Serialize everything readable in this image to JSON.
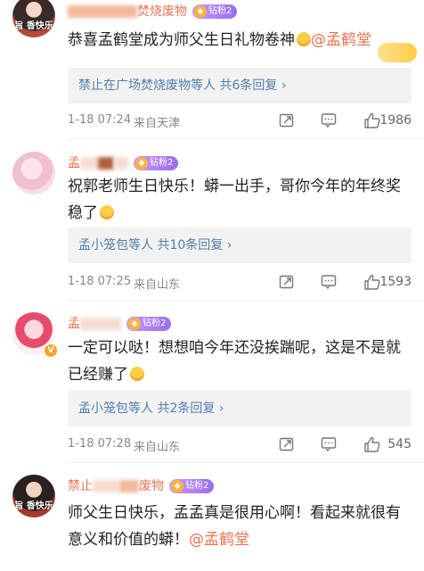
{
  "comments": [
    {
      "avatar_text": "旨 香快乐",
      "username_suffix": "焚烧废物",
      "badge": "钻粉2",
      "text": "恭喜孟鹤堂成为师父生日礼物卷神",
      "mention": "@孟鹤堂",
      "reply_summary": "禁止在广场焚烧废物等人",
      "reply_count": "共6条回复",
      "date": "1-18 07:24",
      "source": "来自天津",
      "likes": "1986"
    },
    {
      "avatar_text": "",
      "username_prefix": "孟",
      "badge": "钻粉2",
      "text": "祝郭老师生日快乐！蟒一出手，哥你今年的年终奖稳了",
      "reply_summary": "孟小笼包等人",
      "reply_count": "共10条回复",
      "date": "1-18 07:25",
      "source": "来自山东",
      "likes": "1593"
    },
    {
      "avatar_text": "",
      "username_prefix": "孟",
      "badge": "钻粉2",
      "text": "一定可以哒！想想咱今年还没挨踹呢，这是不是就已经赚了",
      "reply_summary": "孟小笼包等人",
      "reply_count": "共2条回复",
      "date": "1-18 07:28",
      "source": "来自山东",
      "likes": "545"
    },
    {
      "avatar_text": "旨 香快乐",
      "username_prefix": "禁止",
      "username_suffix": "废物",
      "badge": "钻粉2",
      "text": "师父生日快乐，孟孟真是很用心啊！看起来就很有意义和价值的蟒！",
      "mention": "@孟鹤堂"
    }
  ],
  "reply_arrow": "›",
  "colors": {
    "link": "#507daf",
    "username": "#eb7350",
    "meta": "#888888"
  }
}
